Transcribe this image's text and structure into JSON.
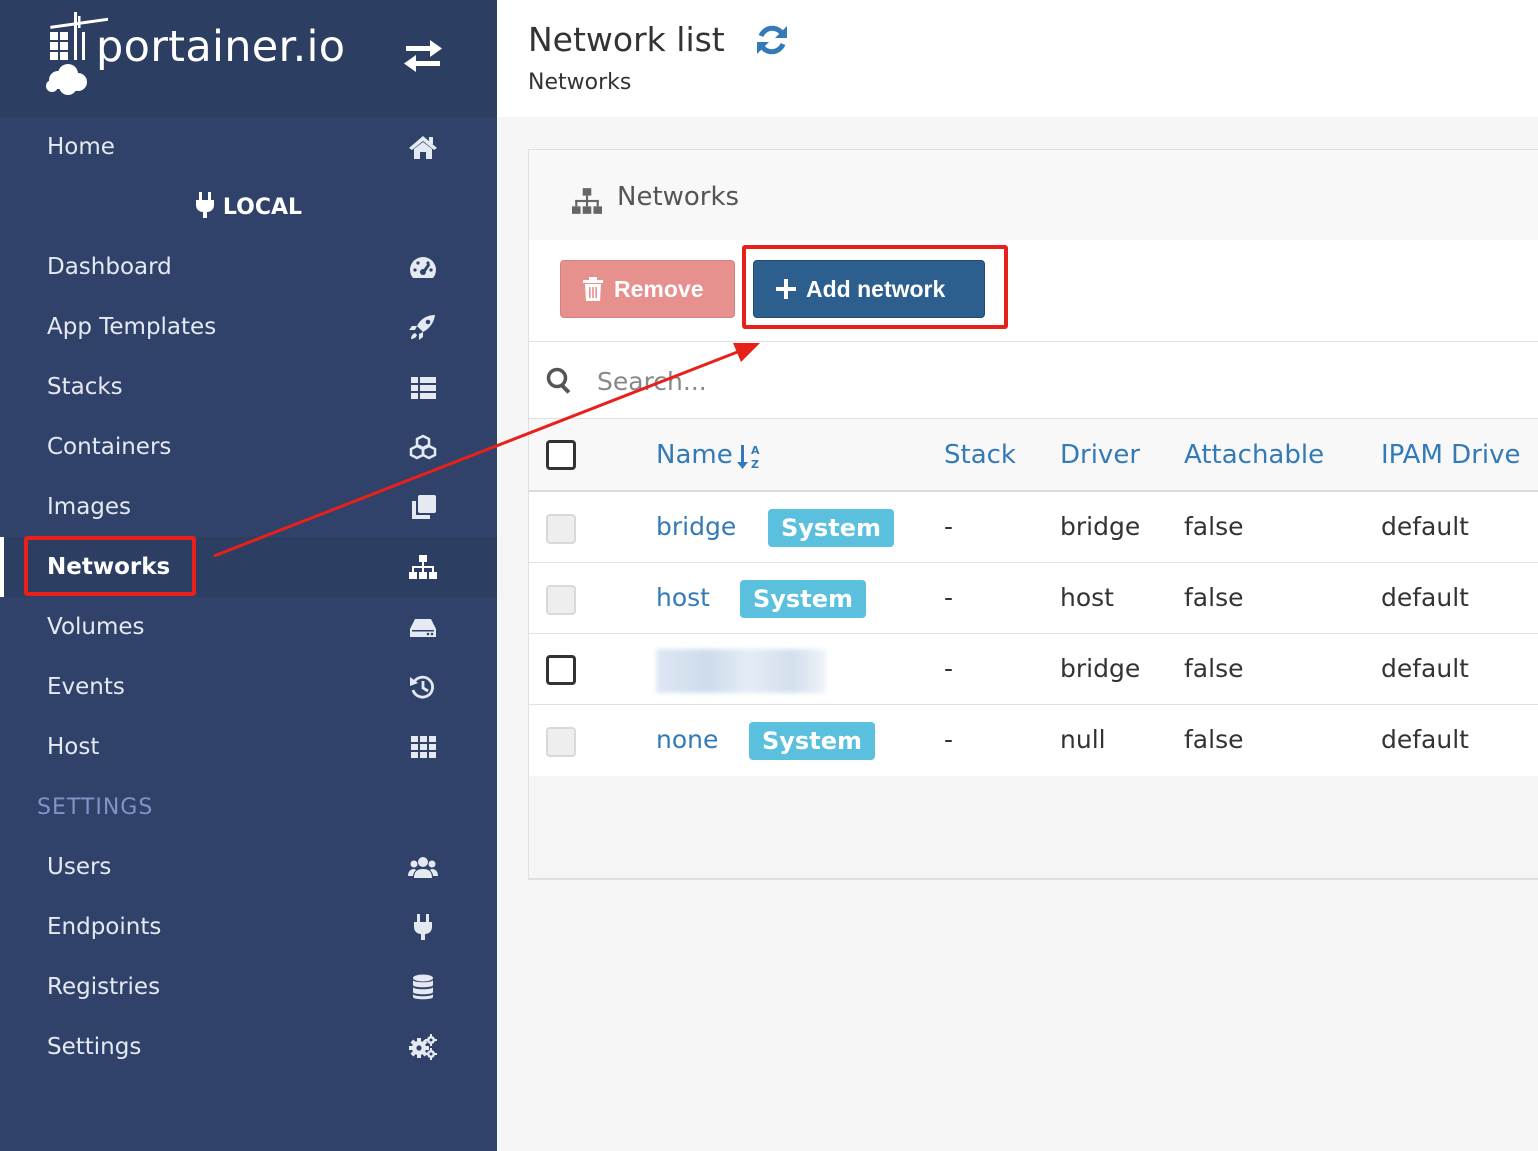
{
  "brand": {
    "name": "portainer.io"
  },
  "sidebar": {
    "home": {
      "label": "Home",
      "icon": "home-icon"
    },
    "endpoint": {
      "label": "LOCAL",
      "icon": "plug-icon"
    },
    "items": [
      {
        "label": "Dashboard",
        "icon": "tachometer-icon",
        "active": false
      },
      {
        "label": "App Templates",
        "icon": "rocket-icon",
        "active": false
      },
      {
        "label": "Stacks",
        "icon": "th-list-icon",
        "active": false
      },
      {
        "label": "Containers",
        "icon": "cubes-icon",
        "active": false
      },
      {
        "label": "Images",
        "icon": "clone-icon",
        "active": false
      },
      {
        "label": "Networks",
        "icon": "sitemap-icon",
        "active": true
      },
      {
        "label": "Volumes",
        "icon": "hdd-icon",
        "active": false
      },
      {
        "label": "Events",
        "icon": "history-icon",
        "active": false
      },
      {
        "label": "Host",
        "icon": "th-icon",
        "active": false
      }
    ],
    "settings_heading": "SETTINGS",
    "settings_items": [
      {
        "label": "Users",
        "icon": "users-icon"
      },
      {
        "label": "Endpoints",
        "icon": "plug-icon"
      },
      {
        "label": "Registries",
        "icon": "database-icon"
      },
      {
        "label": "Settings",
        "icon": "cogs-icon"
      }
    ]
  },
  "header": {
    "title": "Network list",
    "breadcrumb": "Networks",
    "refresh_icon": "refresh-icon"
  },
  "widget": {
    "title": "Networks",
    "icon": "sitemap-icon",
    "remove_label": "Remove",
    "add_label": "Add network",
    "search_placeholder": "Search...",
    "columns": [
      "Name",
      "Stack",
      "Driver",
      "Attachable",
      "IPAM Drive"
    ],
    "rows": [
      {
        "name": "bridge",
        "badge": "System",
        "stack": "-",
        "driver": "bridge",
        "attachable": "false",
        "ipam": "default",
        "selectable": false
      },
      {
        "name": "host",
        "badge": "System",
        "stack": "-",
        "driver": "host",
        "attachable": "false",
        "ipam": "default",
        "selectable": false
      },
      {
        "name": "",
        "badge": "",
        "stack": "-",
        "driver": "bridge",
        "attachable": "false",
        "ipam": "default",
        "selectable": true
      },
      {
        "name": "none",
        "badge": "System",
        "stack": "-",
        "driver": "null",
        "attachable": "false",
        "ipam": "default",
        "selectable": false
      }
    ]
  },
  "colors": {
    "sidebar_bg": "#30426a",
    "brand_bg": "#2d3e63",
    "primary": "#2d5f8e",
    "danger_disabled": "#e7918f",
    "link": "#337ab7",
    "badge_info": "#5bc0de",
    "annotation": "#e8201a"
  }
}
